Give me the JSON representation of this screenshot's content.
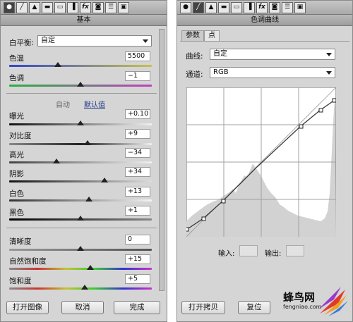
{
  "left": {
    "title": "基本",
    "toolbar": [
      "aperture-icon",
      "histogram-icon",
      "mountain-icon",
      "split-icon",
      "detail-icon",
      "fx-icon",
      "camera-icon",
      "presets-icon",
      "snapshot-icon"
    ],
    "wb_label": "白平衡:",
    "wb_value": "自定",
    "temp": {
      "label": "色温",
      "value": "5500",
      "level": 0.34
    },
    "tint": {
      "label": "色调",
      "value": "−1",
      "level": 0.5
    },
    "auto_label": "自动",
    "default_label": "默认值",
    "exposure": {
      "label": "曝光",
      "value": "+0.10",
      "level": 0.5
    },
    "contrast": {
      "label": "对比度",
      "value": "+9",
      "level": 0.55
    },
    "highlights": {
      "label": "高光",
      "value": "−34",
      "level": 0.33
    },
    "shadows": {
      "label": "阴影",
      "value": "+34",
      "level": 0.67
    },
    "whites": {
      "label": "白色",
      "value": "+13",
      "level": 0.56
    },
    "blacks": {
      "label": "黑色",
      "value": "+1",
      "level": 0.5
    },
    "clarity": {
      "label": "清晰度",
      "value": "0",
      "level": 0.5
    },
    "vibrance": {
      "label": "自然饱和度",
      "value": "+15",
      "level": 0.57
    },
    "saturation": {
      "label": "饱和度",
      "value": "+5",
      "level": 0.53
    },
    "btn_open": "打开图像",
    "btn_cancel": "取消",
    "btn_done": "完成"
  },
  "right": {
    "title": "色调曲线",
    "tab_param": "参数",
    "tab_point": "点",
    "curve_label": "曲线:",
    "curve_value": "自定",
    "channel_label": "通道:",
    "channel_value": "RGB",
    "input_label": "输入:",
    "output_label": "输出:",
    "btn_copy": "打开拷贝",
    "btn_reset": "复位"
  },
  "watermark": {
    "brand": "蜂鸟网",
    "url": "fengniao.com"
  },
  "colors": {
    "accent_link": "#1d3b8a",
    "panel_bg": "#d5d5d5"
  }
}
